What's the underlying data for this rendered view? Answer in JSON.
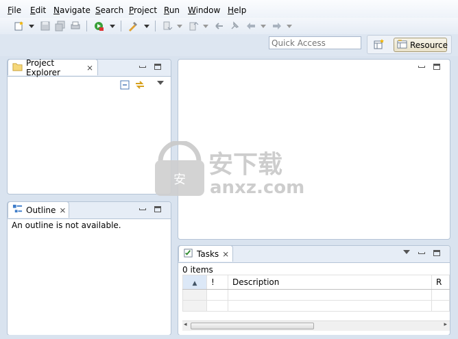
{
  "menu": [
    "File",
    "Edit",
    "Navigate",
    "Search",
    "Project",
    "Run",
    "Window",
    "Help"
  ],
  "quick_access": {
    "placeholder": "Quick Access"
  },
  "perspective": {
    "label": "Resource"
  },
  "project_explorer": {
    "title": "Project Explorer"
  },
  "outline": {
    "title": "Outline",
    "message": "An outline is not available."
  },
  "tasks": {
    "title": "Tasks",
    "count_text": "0 items",
    "columns": [
      "!",
      "Description",
      "R"
    ]
  },
  "watermark": {
    "text": "安下载",
    "sub": "anxz.com"
  },
  "colors": {
    "accent": "#3a6ea5",
    "frame_bg": "#d9e3ef",
    "panel_border": "#b5c4d6"
  }
}
